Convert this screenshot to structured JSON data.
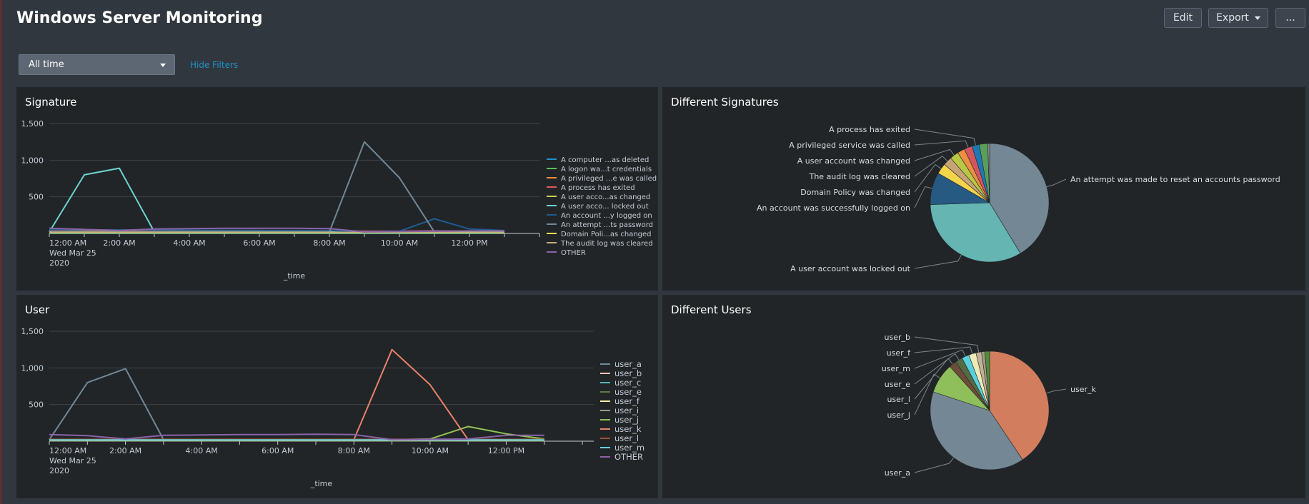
{
  "header": {
    "title": "Windows Server Monitoring",
    "edit_label": "Edit",
    "export_label": "Export",
    "more_label": "..."
  },
  "filters": {
    "time_range": "All time",
    "hide_filters_label": "Hide Filters"
  },
  "panels": {
    "signature": {
      "title": "Signature"
    },
    "diff_signatures": {
      "title": "Different Signatures"
    },
    "user": {
      "title": "User"
    },
    "diff_users": {
      "title": "Different Users"
    }
  },
  "chart_data": [
    {
      "id": "signature-line",
      "type": "line",
      "xlabel": "_time",
      "ylabel": "",
      "x_ticks": [
        "12:00 AM",
        "2:00 AM",
        "4:00 AM",
        "6:00 AM",
        "8:00 AM",
        "10:00 AM",
        "12:00 PM"
      ],
      "x_tick_hours": [
        0,
        2,
        4,
        6,
        8,
        10,
        12
      ],
      "x_first_tick_sub": [
        "Wed Mar 25",
        "2020"
      ],
      "x_range": [
        0,
        14
      ],
      "y_ticks": [
        "500",
        "1,000",
        "1,500"
      ],
      "y_tick_values": [
        500,
        1000,
        1500
      ],
      "ylim": [
        0,
        1500
      ],
      "grid": true,
      "legend": "right",
      "series": [
        {
          "name": "A computer ...as deleted",
          "color": "#1e93c6",
          "x": [
            0,
            13
          ],
          "values": [
            0,
            0
          ]
        },
        {
          "name": "A logon wa...t credentials",
          "color": "#5cc05c",
          "x": [
            0,
            13
          ],
          "values": [
            5,
            5
          ]
        },
        {
          "name": "A privileged ...e was called",
          "color": "#f58f39",
          "x": [
            0,
            1,
            2,
            3,
            4,
            5,
            6,
            7,
            8,
            9,
            10,
            11,
            12,
            13
          ],
          "values": [
            30,
            25,
            20,
            25,
            25,
            30,
            30,
            25,
            25,
            20,
            20,
            25,
            20,
            20
          ]
        },
        {
          "name": "A process has exited",
          "color": "#dd5b5b",
          "x": [
            0,
            1,
            2,
            3,
            4,
            5,
            6,
            7,
            8,
            9,
            10,
            11,
            12,
            13
          ],
          "values": [
            40,
            35,
            30,
            35,
            35,
            40,
            40,
            35,
            35,
            30,
            30,
            35,
            30,
            30
          ]
        },
        {
          "name": "A user acco...as changed",
          "color": "#c6d34f",
          "x": [
            0,
            1,
            2,
            3,
            4,
            5,
            6,
            7,
            8,
            9,
            10,
            11,
            12,
            13
          ],
          "values": [
            20,
            25,
            20,
            20,
            25,
            25,
            30,
            25,
            20,
            20,
            15,
            20,
            20,
            20
          ]
        },
        {
          "name": "A user acco... locked out",
          "color": "#6dd3cf",
          "x": [
            0,
            1,
            2,
            3,
            13
          ],
          "values": [
            20,
            800,
            890,
            20,
            20
          ]
        },
        {
          "name": "An account ...y logged on",
          "color": "#1e5b8f",
          "x": [
            0,
            8,
            9,
            10,
            11,
            12,
            13
          ],
          "values": [
            50,
            40,
            20,
            30,
            200,
            60,
            40
          ]
        },
        {
          "name": "An attempt ...ts password",
          "color": "#738795",
          "x": [
            0,
            8,
            9,
            10,
            11,
            12,
            13
          ],
          "values": [
            20,
            20,
            1250,
            760,
            20,
            20,
            20
          ]
        },
        {
          "name": "Domain Poli...as changed",
          "color": "#f5d94c",
          "x": [
            0,
            13
          ],
          "values": [
            10,
            10
          ]
        },
        {
          "name": "The audit log was cleared",
          "color": "#c4b07c",
          "x": [
            0,
            13
          ],
          "values": [
            15,
            15
          ]
        },
        {
          "name": "OTHER",
          "color": "#8a63ab",
          "x": [
            0,
            1,
            2,
            3,
            4,
            5,
            6,
            7,
            8,
            9,
            10,
            11,
            12,
            13
          ],
          "values": [
            70,
            55,
            40,
            60,
            65,
            70,
            70,
            70,
            65,
            20,
            25,
            30,
            35,
            35
          ]
        }
      ]
    },
    {
      "id": "signature-pie",
      "type": "pie",
      "slices": [
        {
          "label": "An attempt was made to reset an accounts password",
          "value": 41.3,
          "color": "#738795"
        },
        {
          "label": "A user account was locked out",
          "value": 33.2,
          "color": "#65b5b3"
        },
        {
          "label": "An account was successfully logged on",
          "value": 8.8,
          "color": "#275a82"
        },
        {
          "label": "Domain Policy was changed",
          "value": 2.9,
          "color": "#f3d44b"
        },
        {
          "label": "The audit log was cleared",
          "value": 2.4,
          "color": "#c6a477"
        },
        {
          "label": "A user account was changed",
          "value": 2.4,
          "color": "#b9c745"
        },
        {
          "label": "",
          "value": 2.0,
          "color": "#ec8f43"
        },
        {
          "label": "A privileged service was called",
          "value": 2.2,
          "color": "#d4565d"
        },
        {
          "label": "A process has exited",
          "value": 2.0,
          "color": "#1f78b4"
        },
        {
          "label": "",
          "value": 2.3,
          "color": "#5b9e5b"
        },
        {
          "label": "",
          "value": 0.5,
          "color": "#8a8a8a"
        }
      ]
    },
    {
      "id": "user-line",
      "type": "line",
      "xlabel": "_time",
      "ylabel": "",
      "x_ticks": [
        "12:00 AM",
        "2:00 AM",
        "4:00 AM",
        "6:00 AM",
        "8:00 AM",
        "10:00 AM",
        "12:00 PM"
      ],
      "x_tick_hours": [
        0,
        2,
        4,
        6,
        8,
        10,
        12
      ],
      "x_first_tick_sub": [
        "Wed Mar 25",
        "2020"
      ],
      "x_range": [
        0,
        14.3
      ],
      "y_ticks": [
        "500",
        "1,000",
        "1,500"
      ],
      "y_tick_values": [
        500,
        1000,
        1500
      ],
      "ylim": [
        0,
        1500
      ],
      "grid": true,
      "legend": "right",
      "series": [
        {
          "name": "user_a",
          "color": "#738795",
          "x": [
            0,
            1,
            2,
            3,
            13
          ],
          "values": [
            20,
            800,
            990,
            20,
            20
          ]
        },
        {
          "name": "user_b",
          "color": "#f5c6b0",
          "x": [
            0,
            13
          ],
          "values": [
            10,
            10
          ]
        },
        {
          "name": "user_c",
          "color": "#4bb9b4",
          "x": [
            0,
            13
          ],
          "values": [
            15,
            15
          ]
        },
        {
          "name": "user_e",
          "color": "#5a7e3c",
          "x": [
            0,
            13
          ],
          "values": [
            5,
            5
          ]
        },
        {
          "name": "user_f",
          "color": "#f6f0a3",
          "x": [
            0,
            13
          ],
          "values": [
            8,
            8
          ]
        },
        {
          "name": "user_i",
          "color": "#9a9a86",
          "x": [
            0,
            13
          ],
          "values": [
            12,
            12
          ]
        },
        {
          "name": "user_j",
          "color": "#8fc452",
          "x": [
            0,
            9,
            10,
            11,
            12,
            13
          ],
          "values": [
            20,
            20,
            30,
            200,
            100,
            30
          ]
        },
        {
          "name": "user_k",
          "color": "#e8826b",
          "x": [
            0,
            8,
            9,
            10,
            11,
            13
          ],
          "values": [
            20,
            20,
            1250,
            770,
            20,
            20
          ]
        },
        {
          "name": "user_l",
          "color": "#a0522d",
          "x": [
            0,
            13
          ],
          "values": [
            25,
            25
          ]
        },
        {
          "name": "user_m",
          "color": "#5fd3e0",
          "x": [
            0,
            13
          ],
          "values": [
            18,
            18
          ]
        },
        {
          "name": "OTHER",
          "color": "#8a63ab",
          "x": [
            0,
            1,
            2,
            3,
            4,
            5,
            6,
            7,
            8,
            9,
            10,
            11,
            12,
            13
          ],
          "values": [
            90,
            75,
            30,
            80,
            85,
            90,
            90,
            95,
            90,
            20,
            25,
            30,
            80,
            80
          ]
        }
      ]
    },
    {
      "id": "user-pie",
      "type": "pie",
      "slices": [
        {
          "label": "user_k",
          "value": 40.6,
          "color": "#d27e5e"
        },
        {
          "label": "user_a",
          "value": 39.5,
          "color": "#738795"
        },
        {
          "label": "user_j",
          "value": 8.2,
          "color": "#8fbf5b"
        },
        {
          "label": "user_l",
          "value": 2.0,
          "color": "#6d4c3a"
        },
        {
          "label": "user_e",
          "value": 2.0,
          "color": "#556b43"
        },
        {
          "label": "user_m",
          "value": 2.0,
          "color": "#59d0dd"
        },
        {
          "label": "user_f",
          "value": 2.0,
          "color": "#eee9b8"
        },
        {
          "label": "user_b",
          "value": 1.5,
          "color": "#c4b093"
        },
        {
          "label": "",
          "value": 0.9,
          "color": "#a29c87"
        },
        {
          "label": "",
          "value": 1.3,
          "color": "#4d8c3a"
        }
      ]
    }
  ]
}
